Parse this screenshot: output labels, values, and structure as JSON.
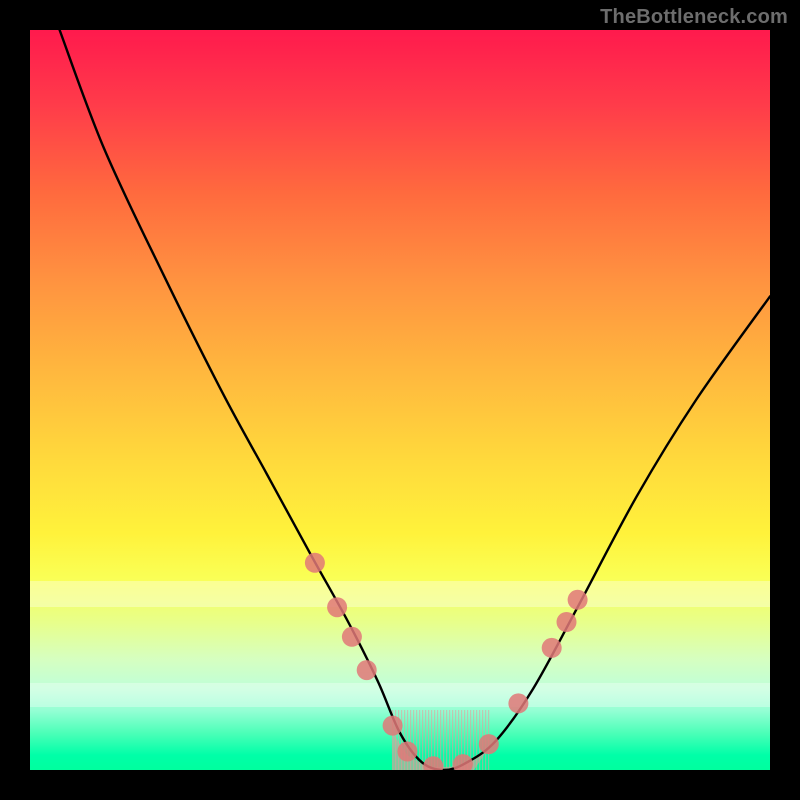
{
  "watermark": "TheBottleneck.com",
  "chart_data": {
    "type": "line",
    "title": "",
    "xlabel": "",
    "ylabel": "",
    "xlim": [
      0,
      100
    ],
    "ylim": [
      0,
      100
    ],
    "series": [
      {
        "name": "curve",
        "x": [
          4,
          10,
          18,
          26,
          32,
          38,
          43,
          47,
          50,
          53,
          56,
          59,
          63,
          68,
          74,
          82,
          90,
          100
        ],
        "y": [
          100,
          84,
          67,
          51,
          40,
          29,
          20,
          12,
          5,
          1,
          0,
          1,
          4,
          11,
          22,
          37,
          50,
          64
        ]
      }
    ],
    "markers": {
      "name": "highlight-dots",
      "color": "#e07878",
      "points": [
        {
          "x": 38.5,
          "y": 28
        },
        {
          "x": 41.5,
          "y": 22
        },
        {
          "x": 43.5,
          "y": 18
        },
        {
          "x": 45.5,
          "y": 13.5
        },
        {
          "x": 49,
          "y": 6
        },
        {
          "x": 51,
          "y": 2.5
        },
        {
          "x": 54.5,
          "y": 0.5
        },
        {
          "x": 58.5,
          "y": 0.8
        },
        {
          "x": 62,
          "y": 3.5
        },
        {
          "x": 66,
          "y": 9
        },
        {
          "x": 70.5,
          "y": 16.5
        },
        {
          "x": 72.5,
          "y": 20
        },
        {
          "x": 74,
          "y": 23
        }
      ]
    },
    "valley_fill": {
      "name": "valley-hatch",
      "color": "#e99a9a",
      "polygon_x": [
        49,
        51,
        54,
        58,
        62,
        60,
        56,
        52
      ],
      "polygon_y": [
        5,
        2,
        0.3,
        0.5,
        3,
        0,
        0,
        0
      ]
    },
    "bands": [
      {
        "name": "highlight-band-upper",
        "y_from": 22,
        "y_to": 25.5
      },
      {
        "name": "highlight-band-lower",
        "y_from": 8.6,
        "y_to": 11.8
      }
    ]
  }
}
